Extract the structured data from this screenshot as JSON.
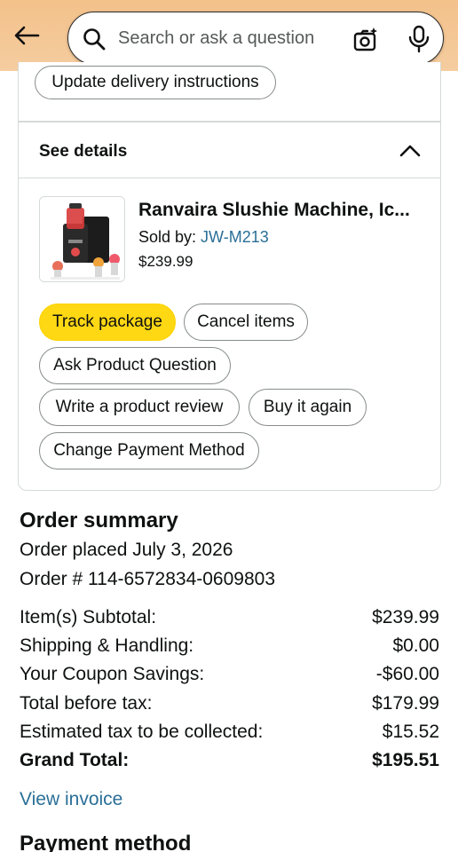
{
  "header": {
    "search_placeholder": "Search or ask a question"
  },
  "delivery": {
    "update_button": "Update delivery instructions"
  },
  "details": {
    "heading": "See details",
    "product": {
      "title": "Ranvaira Slushie Machine, Ic...",
      "sold_by_label": "Sold by: ",
      "seller": "JW-M213",
      "price": "$239.99"
    },
    "actions": {
      "track": "Track package",
      "cancel": "Cancel items",
      "ask": "Ask Product Question",
      "review": "Write a product review",
      "buy_again": "Buy it again",
      "change_payment": "Change Payment Method"
    }
  },
  "summary": {
    "title": "Order summary",
    "placed": "Order placed July 3, 2026",
    "order_number": "Order # 114-6572834-0609803",
    "rows": [
      {
        "label": "Item(s) Subtotal:",
        "value": "$239.99"
      },
      {
        "label": "Shipping & Handling:",
        "value": "$0.00"
      },
      {
        "label": "Your Coupon Savings:",
        "value": "-$60.00"
      },
      {
        "label": "Total before tax:",
        "value": "$179.99"
      },
      {
        "label": "Estimated tax to be collected:",
        "value": "$15.52"
      },
      {
        "label": "Grand Total:",
        "value": "$195.51"
      }
    ],
    "invoice_link": "View invoice"
  },
  "payment": {
    "title": "Payment method"
  },
  "colors": {
    "header_bg": "#f3c18a",
    "primary_button": "#ffd814",
    "link": "#2a6f97"
  },
  "icons": [
    "back-arrow-icon",
    "search-icon",
    "camera-lens-icon",
    "microphone-icon",
    "chevron-up-icon"
  ]
}
